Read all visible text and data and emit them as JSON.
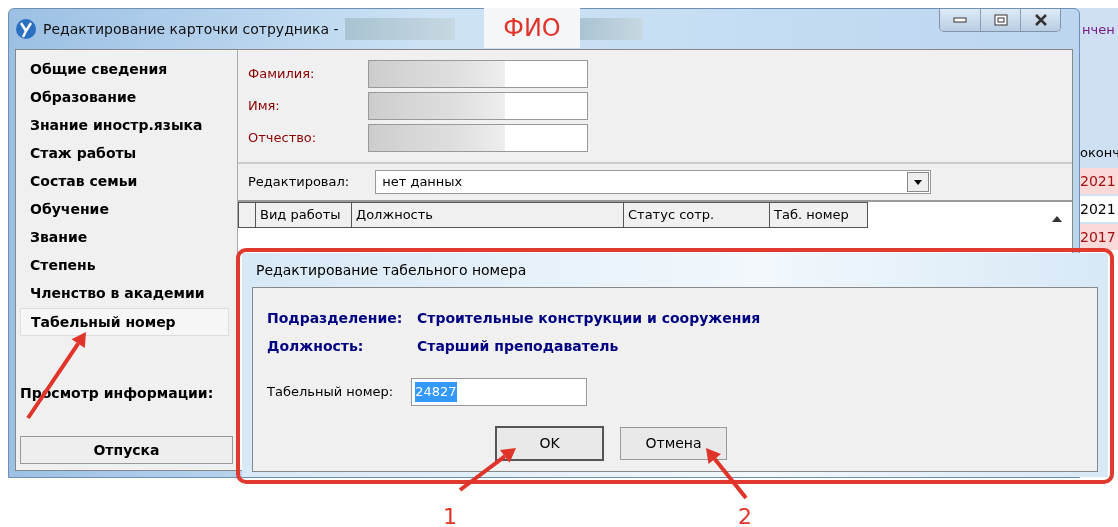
{
  "window": {
    "title": "Редактирование карточки сотрудника -"
  },
  "annotation": {
    "label": "ФИО"
  },
  "sidebar": {
    "items": [
      {
        "label": "Общие сведения",
        "selected": false
      },
      {
        "label": "Образование",
        "selected": false
      },
      {
        "label": "Знание иностр.языка",
        "selected": false
      },
      {
        "label": "Стаж работы",
        "selected": false
      },
      {
        "label": "Состав семьи",
        "selected": false
      },
      {
        "label": "Обучение",
        "selected": false
      },
      {
        "label": "Звание",
        "selected": false
      },
      {
        "label": "Степень",
        "selected": false
      },
      {
        "label": "Членство в академии",
        "selected": false
      },
      {
        "label": "Табельный номер",
        "selected": true
      }
    ],
    "view_label": "Просмотр информации:",
    "button": "Отпуска"
  },
  "form": {
    "fields": [
      {
        "label": "Фамилия:"
      },
      {
        "label": "Имя:"
      },
      {
        "label": "Отчество:"
      }
    ],
    "editor": {
      "label": "Редактировал:",
      "value": "нет данных"
    }
  },
  "table": {
    "columns": [
      "Вид работы",
      "Должность",
      "Статус сотр.",
      "Таб. номер"
    ]
  },
  "dialog": {
    "title": "Редактирование табельного номера",
    "info": [
      {
        "label": "Подразделение:",
        "value": "Строительные конструкции и сооружения"
      },
      {
        "label": "Должность:",
        "value": "Старший преподаватель"
      }
    ],
    "field": {
      "label": "Табельный номер:",
      "value": "24827"
    },
    "buttons": [
      "OK",
      "Отмена"
    ]
  },
  "background_window": {
    "header": "нчен",
    "column": "оконч",
    "cells": [
      {
        "text": "2021",
        "highlighted": true
      },
      {
        "text": "2021",
        "highlighted": false
      },
      {
        "text": "2017",
        "highlighted": true
      }
    ]
  },
  "callouts": [
    {
      "label": "1"
    },
    {
      "label": "2"
    }
  ]
}
